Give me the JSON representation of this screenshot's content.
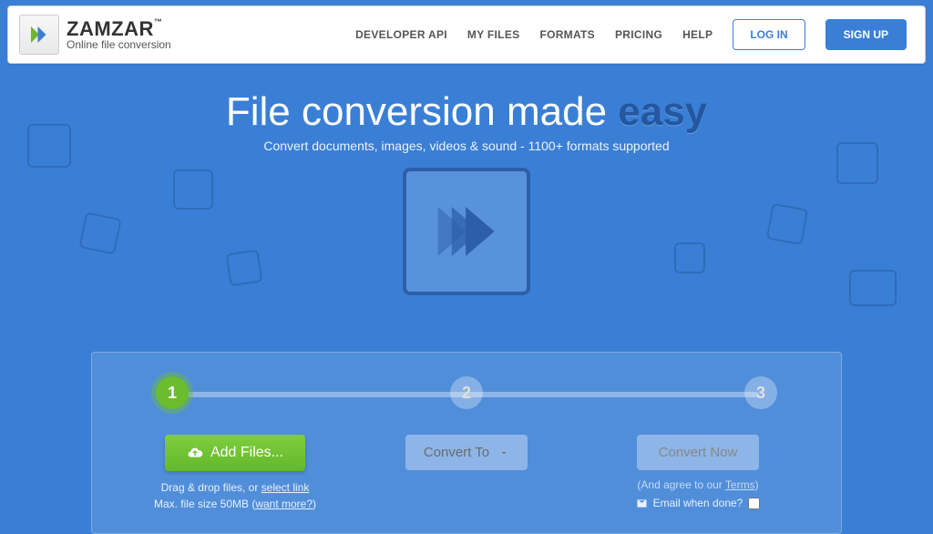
{
  "header": {
    "brand_name": "ZAMZAR",
    "brand_tm": "™",
    "brand_tagline": "Online file conversion",
    "nav": {
      "developer_api": "DEVELOPER API",
      "my_files": "MY FILES",
      "formats": "FORMATS",
      "pricing": "PRICING",
      "help": "HELP"
    },
    "login": "LOG IN",
    "signup": "SIGN UP"
  },
  "hero": {
    "title_prefix": "File conversion made ",
    "title_emphasis": "easy",
    "subtitle": "Convert documents, images, videos & sound - 1100+ formats supported"
  },
  "steps": {
    "s1": "1",
    "s2": "2",
    "s3": "3"
  },
  "actions": {
    "add_files": "Add Files...",
    "hint_line1_pre": "Drag & drop files, or ",
    "hint_line1_link": "select link",
    "hint_line2_pre": "Max. file size 50MB (",
    "hint_line2_link": "want more?",
    "hint_line2_post": ")",
    "convert_to": "Convert To",
    "convert_now": "Convert Now",
    "terms_pre": "(And agree to our ",
    "terms_link": "Terms",
    "terms_post": ")",
    "email_label": "Email when done?"
  }
}
